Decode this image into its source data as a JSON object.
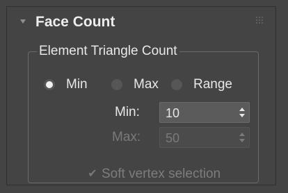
{
  "rollout": {
    "title": "Face Count",
    "collapse_icon": "triangle-down-icon",
    "grip_icon": "grip-dots-icon"
  },
  "group": {
    "title": "Element Triangle Count"
  },
  "mode_options": [
    {
      "label": "Min",
      "selected": true
    },
    {
      "label": "Max",
      "selected": false
    },
    {
      "label": "Range",
      "selected": false
    }
  ],
  "fields": {
    "min": {
      "label": "Min:",
      "value": "10",
      "enabled": true
    },
    "max": {
      "label": "Max:",
      "value": "50",
      "enabled": false
    }
  },
  "soft_selection": {
    "label": "Soft vertex selection",
    "checked": true,
    "enabled": false
  },
  "colors": {
    "background": "#444444",
    "text": "#e8e8e8",
    "disabled_text": "#7d7d7d"
  }
}
